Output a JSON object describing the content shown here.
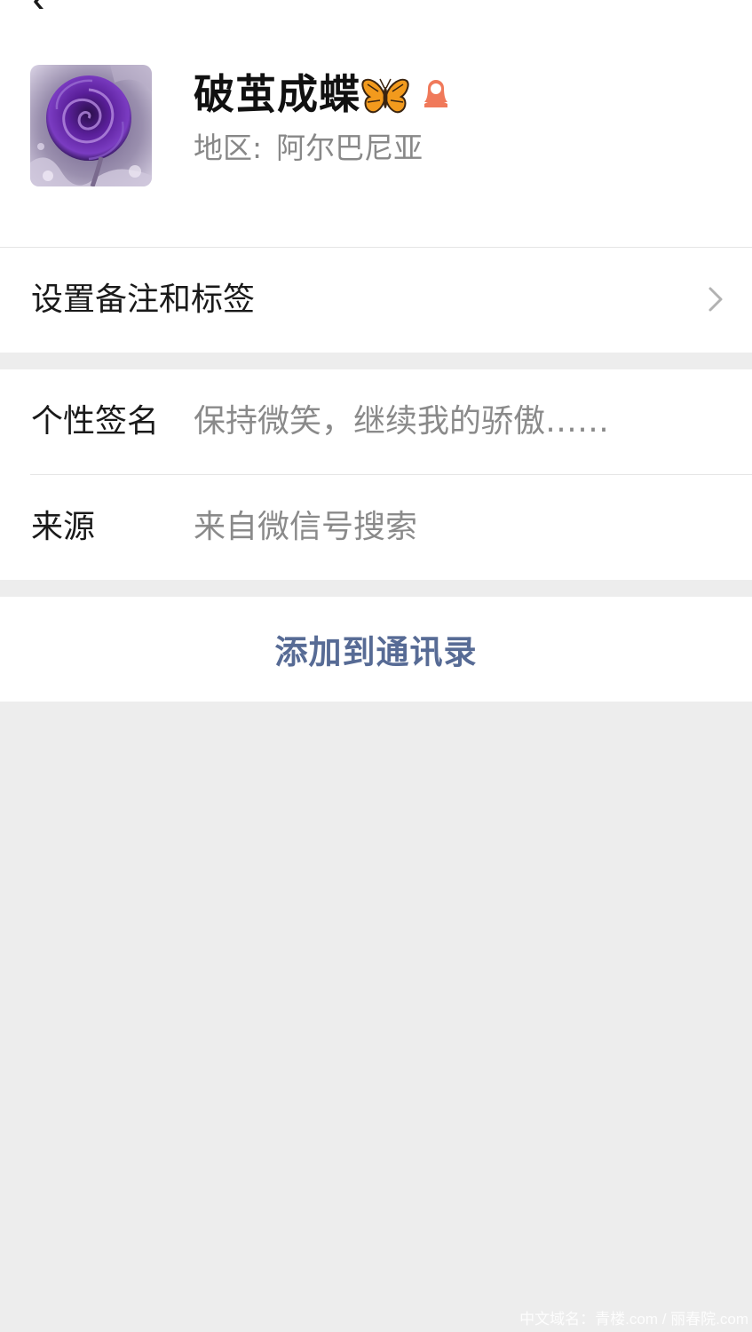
{
  "profile": {
    "nickname": "破茧成蝶",
    "region_label": "地区:",
    "region_value": "阿尔巴尼亚",
    "avatar": "purple-rose-photo",
    "nickname_emoji": "butterfly-icon",
    "gender_icon": "female-icon"
  },
  "remark": {
    "label": "设置备注和标签"
  },
  "info": {
    "signature_label": "个性签名",
    "signature_value": "保持微笑，继续我的骄傲……",
    "source_label": "来源",
    "source_value": "来自微信号搜索"
  },
  "actions": {
    "add_contact": "添加到通讯录"
  },
  "watermark": "中文域名：青楼.com / 丽春院.com",
  "colors": {
    "link_blue": "#576b95",
    "page_bg": "#ededed",
    "secondary_text": "#888888",
    "female_icon": "#f0795a"
  }
}
